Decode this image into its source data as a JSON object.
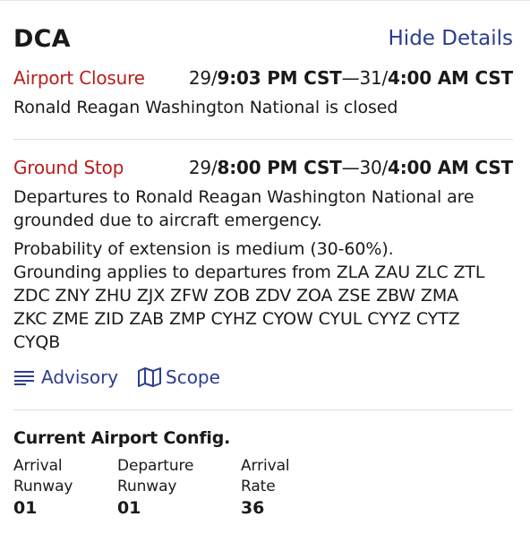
{
  "header": {
    "code": "DCA",
    "hide_details": "Hide Details"
  },
  "closure": {
    "title": "Airport Closure",
    "start_day": "29/",
    "start_time": "9:03 PM CST",
    "sep": "—",
    "end_day": "31/",
    "end_time": "4:00 AM CST",
    "text": "Ronald Reagan Washington National is closed"
  },
  "ground_stop": {
    "title": "Ground Stop",
    "start_day": "29/",
    "start_time": "8:00 PM CST",
    "sep": "—",
    "end_day": "30/",
    "end_time": "4:00 AM CST",
    "line1": "Departures to Ronald Reagan Washington National are",
    "line2": "grounded due to aircraft emergency.",
    "line3": "Probability of extension is medium (30-60%).",
    "line4": "Grounding applies to departures from ZLA ZAU ZLC ZTL",
    "line5": "ZDC ZNY ZHU ZJX ZFW ZOB ZDV ZOA ZSE ZBW ZMA",
    "line6": "ZKC ZME ZID ZAB ZMP CYHZ CYOW CYUL CYYZ CYTZ",
    "line7": "CYQB"
  },
  "links": {
    "advisory": "Advisory",
    "scope": "Scope"
  },
  "config": {
    "title": "Current Airport Config.",
    "arrival_runway": {
      "label1": "Arrival",
      "label2": "Runway",
      "value": "01"
    },
    "departure_runway": {
      "label1": "Departure",
      "label2": "Runway",
      "value": "01"
    },
    "arrival_rate": {
      "label1": "Arrival",
      "label2": "Rate",
      "value": "36"
    }
  },
  "colors": {
    "accent": "#2b3d8f",
    "alert": "#b91c1c",
    "text": "#1a1a1a",
    "divider": "#dcdcdc"
  }
}
